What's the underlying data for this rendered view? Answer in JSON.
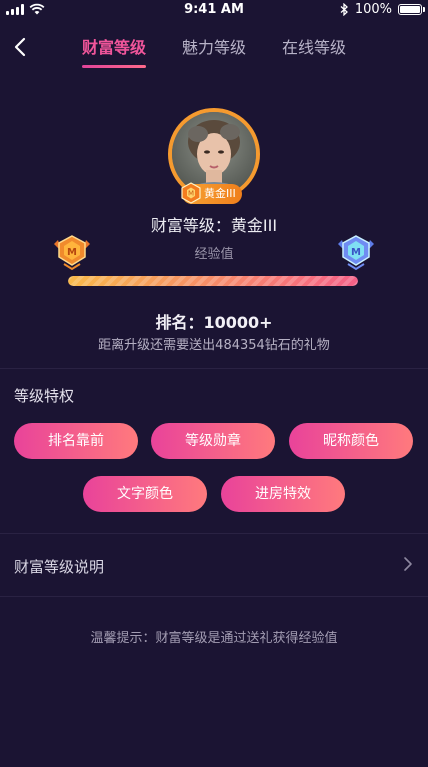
{
  "status_bar": {
    "time": "9:41 AM",
    "battery": "100%"
  },
  "nav": {
    "tabs": [
      {
        "label": "财富等级",
        "active": true
      },
      {
        "label": "魅力等级",
        "active": false
      },
      {
        "label": "在线等级",
        "active": false
      }
    ]
  },
  "profile": {
    "badge": "黄金III",
    "level_title": "财富等级：黄金III",
    "exp_label": "经验值",
    "progress_fraction": 1.0,
    "rank": "排名：10000+",
    "upgrade_hint": "距离升级还需要送出484354钻石的礼物"
  },
  "privileges": {
    "title": "等级特权",
    "items": [
      "排名靠前",
      "等级勋章",
      "昵称颜色",
      "文字颜色",
      "进房特效"
    ]
  },
  "explain": {
    "label": "财富等级说明"
  },
  "tip": "温馨提示：财富等级是通过送礼获得经验值",
  "colors": {
    "accent": "#f0559a",
    "background": "#1b1433",
    "gold": "#f59a2f"
  }
}
